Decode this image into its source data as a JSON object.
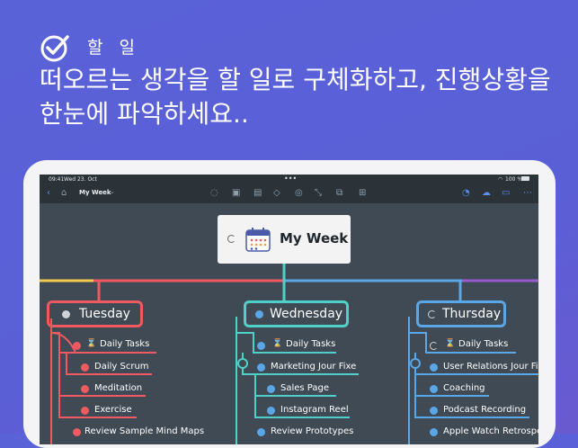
{
  "promo": {
    "section_label": "할 일",
    "headline": "떠오르는 생각을 할 일로 구체화하고, 진행상황을 한눈에 파악하세요.."
  },
  "status_bar": {
    "time": "09:41",
    "date": "Wed 23. Oct",
    "battery": "100 %"
  },
  "toolbar": {
    "document_title": "My Week"
  },
  "mindmap": {
    "root": {
      "title": "My Week",
      "icon": "calendar-icon"
    },
    "branches": [
      {
        "day": "Tuesday",
        "color": "#ef5a61",
        "tasks": [
          "Daily Tasks",
          "Daily Scrum",
          "Meditation",
          "Exercise",
          "Review Sample Mind Maps"
        ]
      },
      {
        "day": "Wednesday",
        "color": "#4fd1c8",
        "tasks": [
          "Daily Tasks",
          "Marketing Jour Fixe",
          "Sales Page",
          "Instagram Reel",
          "Review Prototypes"
        ]
      },
      {
        "day": "Thursday",
        "color": "#5aa6e6",
        "tasks": [
          "Daily Tasks",
          "User Relations Jour Fixe",
          "Coaching",
          "Podcast Recording",
          "Apple Watch Retrospective"
        ]
      }
    ],
    "colors": {
      "yellow": "#f2c94c",
      "purple": "#9b59d0",
      "check": "#ef5a61"
    }
  }
}
